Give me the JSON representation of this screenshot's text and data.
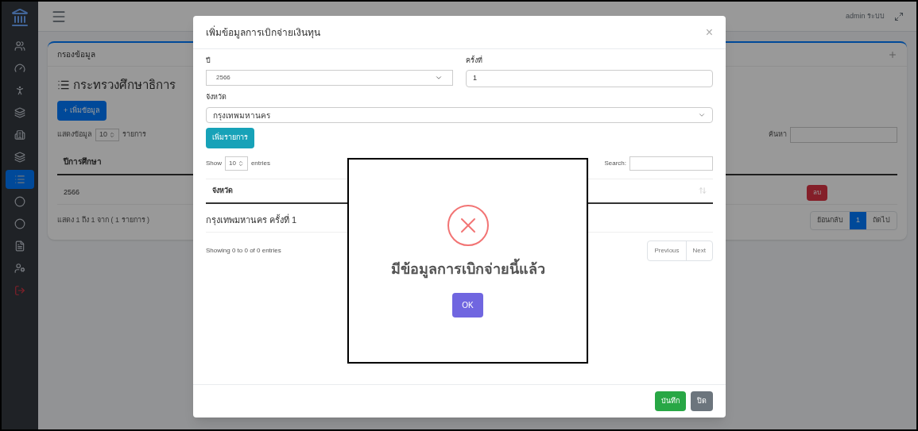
{
  "sidebar": {
    "items": [
      {
        "selected": false
      },
      {
        "selected": false
      },
      {
        "selected": false
      },
      {
        "selected": false
      },
      {
        "selected": false
      },
      {
        "selected": false
      },
      {
        "selected": true
      },
      {
        "selected": false
      },
      {
        "selected": false
      },
      {
        "selected": false
      },
      {
        "selected": false
      },
      {
        "selected": false
      }
    ]
  },
  "topbar": {
    "user": "admin ระบบ"
  },
  "page": {
    "filter_title": "กรองข้อมูล",
    "heading": "กระทรวงศึกษาธิการ",
    "add_button": "+ เพิ่มข้อมูล",
    "length_prefix": "แสดงข้อมูล",
    "length_value": "10",
    "length_suffix": "รายการ",
    "search_label": "ค้นหา",
    "column": "ปีการศึกษา",
    "rows": [
      {
        "year": "2566",
        "action": "ลบ"
      }
    ],
    "info": "แสดง 1 ถึง 1 จาก ( 1 รายการ )",
    "pagination": [
      {
        "label": "ย้อนกลับ",
        "selected": false
      },
      {
        "label": "1",
        "selected": true
      },
      {
        "label": "ถัดไป",
        "selected": false
      }
    ]
  },
  "modal": {
    "title": "เพิ่มข้อมูลการเบิกจ่ายเงินทุน",
    "close": "×",
    "year_label": "ปี",
    "year_value": "2566",
    "round_label": "ครั้งที่",
    "round_value": "1",
    "province_label": "จังหวัด",
    "province_value": "กรุงเทพมหานคร",
    "add_item": "เพิ่มรายการ",
    "show": "Show",
    "entries_value": "10",
    "entries": "entries",
    "search": "Search:",
    "column": "จังหวัด",
    "rows": [
      "กรุงเทพมหานคร ครั้งที่ 1"
    ],
    "info": "Showing 0 to 0 of 0 entries",
    "pager": [
      "Previous",
      "Next"
    ],
    "save": "บันทึก",
    "cancel": "ปิด"
  },
  "alert": {
    "message": "มีข้อมูลการเบิกจ่ายนี้แล้ว",
    "ok": "OK"
  }
}
